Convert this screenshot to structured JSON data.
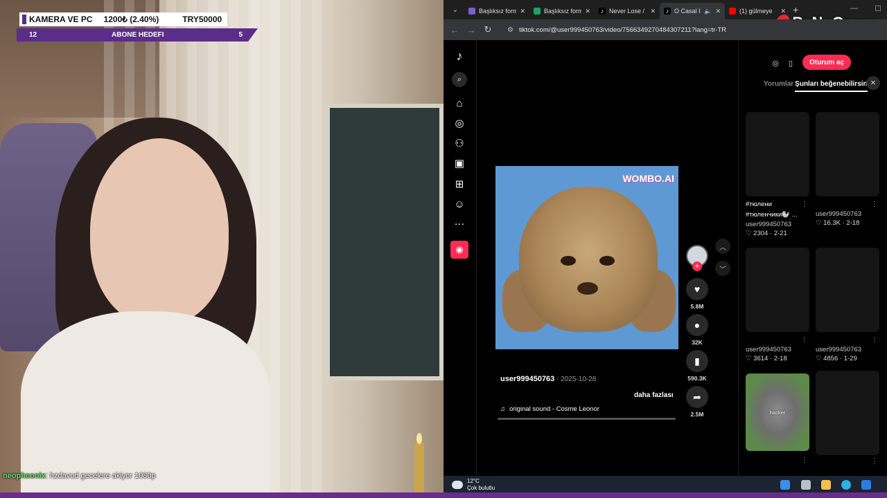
{
  "overlay": {
    "goal_title": "KAMERA VE PC",
    "goal_amount": "1200₺ (2.40%)",
    "goal_target": "TRY50000",
    "sub_left": "12",
    "sub_label": "ABONE HEDEFI",
    "sub_right": "5",
    "chat_user": "neopheonix",
    "chat_message": ": hzdavud gecelere akiyor 1080p"
  },
  "browser": {
    "tabs": [
      {
        "title": "Başlıksız form",
        "icon_color": "#7b5cd6"
      },
      {
        "title": "Başlıksız form",
        "icon_color": "#1ea362"
      },
      {
        "title": "Never Lose /",
        "icon_color": "#ffffff"
      },
      {
        "title": "O Casal I",
        "icon_color": "#ffffff",
        "active": true
      },
      {
        "title": "(1) gülmeye",
        "icon_color": "#ff0000"
      }
    ],
    "url": "tiktok.com/@user999450763/video/7566349270484307211?lang=tr-TR",
    "brand": "ByNoGame"
  },
  "tiktok": {
    "video": {
      "watermark": "WOMBO.AI",
      "author": "user999450763",
      "date": " · 2025-10-28",
      "more": "daha fazlası",
      "sound": "original sound - Cosme Leonor"
    },
    "actions": {
      "likes": "5.8M",
      "comments": "32K",
      "saves": "590.3K",
      "shares": "2.5M"
    },
    "header": {
      "login": "Oturum aç",
      "tab_comments": "Yorumlar",
      "tab_suggestions": "Şunları beğenebilirsin"
    },
    "suggestions": [
      {
        "caption": "#тюлени #тюленчики🦭 ...",
        "author": "user999450763",
        "stats": "♡ 2304 · 2-21"
      },
      {
        "caption": "",
        "author": "user999450763",
        "stats": "♡ 16.3K · 2-18"
      },
      {
        "caption": "",
        "author": "user999450763",
        "stats": "♡ 3614 · 2-18"
      },
      {
        "caption": "",
        "author": "user999450763",
        "stats": "♡ 4856 · 1-29"
      },
      {
        "caption": "",
        "author": "",
        "stats": "",
        "thumb_text": "hacker"
      },
      {
        "caption": "",
        "author": "",
        "stats": ""
      }
    ]
  },
  "taskbar": {
    "temp": "12°C",
    "weather": "Çok bulutlu"
  }
}
